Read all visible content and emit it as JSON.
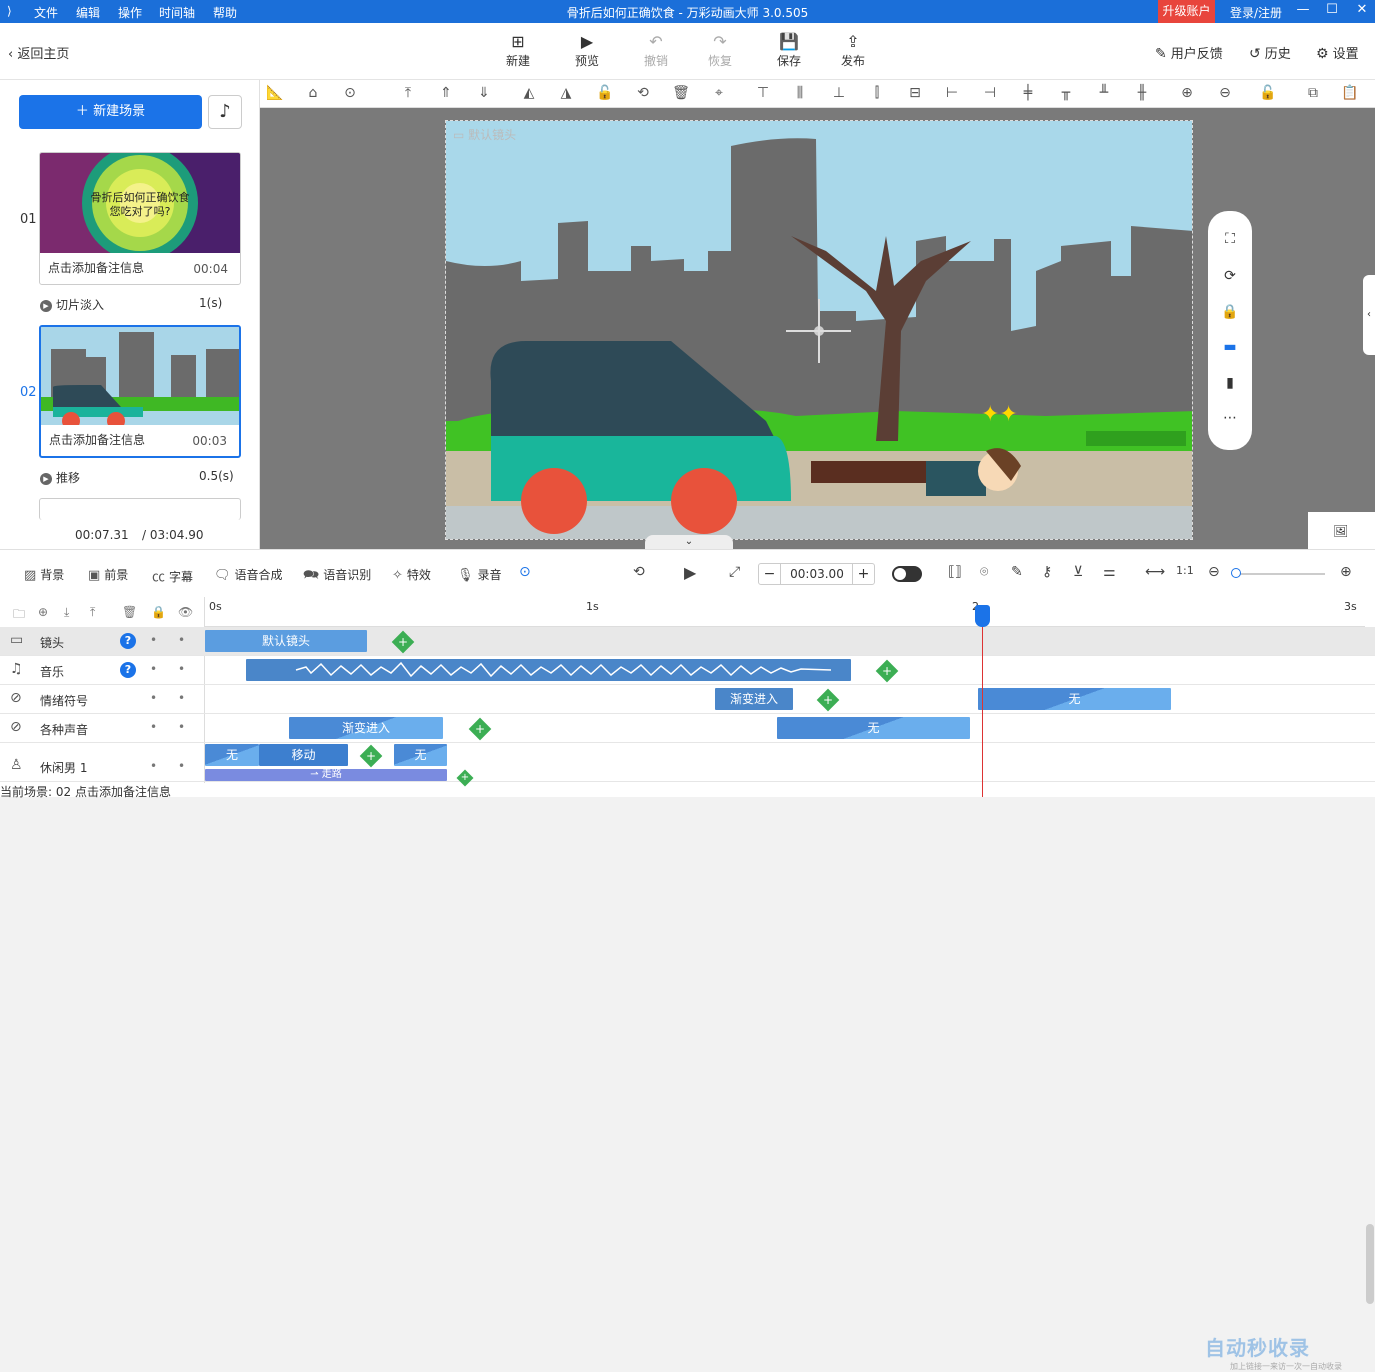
{
  "titlebar": {
    "menus": [
      "文件",
      "编辑",
      "操作",
      "时间轴",
      "帮助"
    ],
    "title": "骨折后如何正确饮食 - 万彩动画大师 3.0.505",
    "upgrade": "升级账户",
    "login": "登录/注册"
  },
  "toolbar": {
    "back": "返回主页",
    "new": "新建",
    "preview": "预览",
    "undo": "撤销",
    "redo": "恢复",
    "save": "保存",
    "publish": "发布",
    "feedback": "用户反馈",
    "history": "历史",
    "settings": "设置"
  },
  "scenes": {
    "new_scene": "新建场景",
    "items": [
      {
        "num": "01",
        "note": "点击添加备注信息",
        "duration": "00:04",
        "thumb_text": "骨折后如何正确饮食\n您吃对了吗?",
        "transition": "切片淡入",
        "transition_time": "1(s)"
      },
      {
        "num": "02",
        "note": "点击添加备注信息",
        "duration": "00:03",
        "transition": "推移",
        "transition_time": "0.5(s)"
      }
    ],
    "current_time": "00:07.31",
    "total_time": "/ 03:04.90"
  },
  "stage": {
    "camera_label": "默认镜头"
  },
  "bottom": {
    "background": "背景",
    "foreground": "前景",
    "subtitle": "字幕",
    "tts": "语音合成",
    "asr": "语音识别",
    "effects": "特效",
    "record": "录音",
    "time": "00:03.00"
  },
  "timeline": {
    "ruler": [
      "0s",
      "1s",
      "2",
      "3s"
    ],
    "tracks": [
      {
        "name": "镜头",
        "clips": [
          "默认镜头"
        ]
      },
      {
        "name": "音乐"
      },
      {
        "name": "情绪符号",
        "clips": [
          "渐变进入",
          "无"
        ]
      },
      {
        "name": "各种声音",
        "clips": [
          "渐变进入",
          "无"
        ]
      },
      {
        "name": "休闲男 1",
        "clips": [
          "无",
          "移动",
          "无"
        ]
      }
    ],
    "partial_clip": "走路"
  },
  "status": {
    "text": "当前场景: 02   点击添加备注信息"
  },
  "watermark": {
    "big": "自动秒收录",
    "small": "加上链接一来访一次一自动收录"
  },
  "colors": {
    "accent": "#1b73e8",
    "titlebar": "#1b6fd9",
    "upgrade": "#e8453c",
    "add": "#3cae54"
  }
}
